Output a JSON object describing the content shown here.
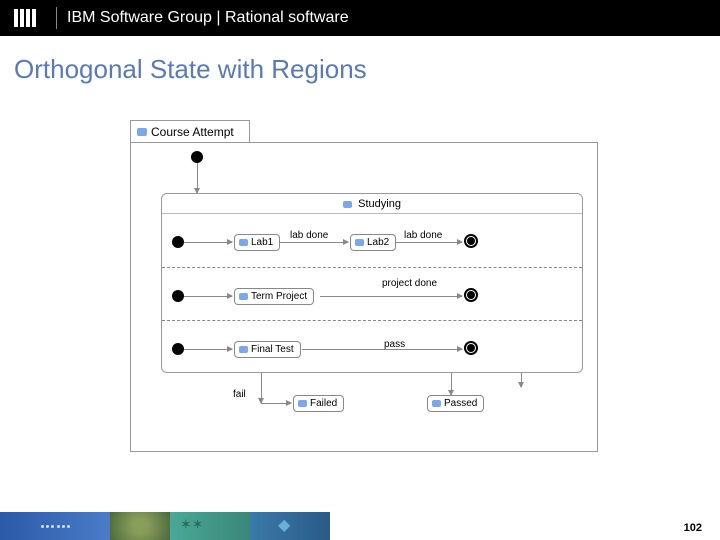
{
  "header": {
    "logo_alt": "IBM",
    "text": "IBM Software Group | Rational software"
  },
  "title": "Orthogonal State with Regions",
  "diagram": {
    "outer_state": "Course Attempt",
    "composite_state": "Studying",
    "regions": [
      {
        "states": [
          "Lab1",
          "Lab2"
        ],
        "transitions": [
          "lab done",
          "lab done"
        ]
      },
      {
        "states": [
          "Term Project"
        ],
        "transitions": [
          "project done"
        ]
      },
      {
        "states": [
          "Final Test"
        ],
        "transitions": [
          "pass"
        ]
      }
    ],
    "exit_transitions": {
      "fail": "fail",
      "failed_state": "Failed",
      "passed_state": "Passed"
    }
  },
  "page_number": "102"
}
